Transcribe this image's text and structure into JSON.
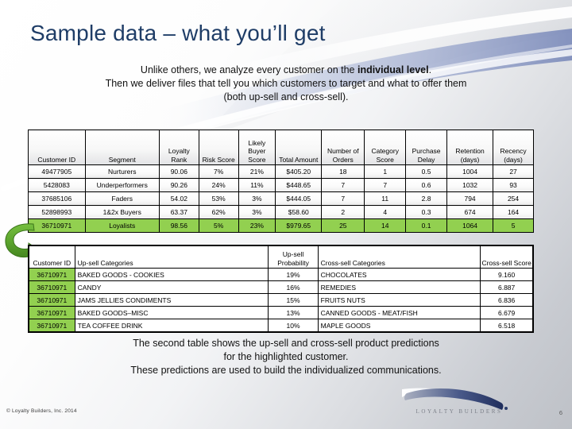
{
  "slide": {
    "title": "Sample data – what you’ll get",
    "intro_line1_a": "Unlike others, we analyze every customer on the ",
    "intro_line1_b": "individual level",
    "intro_line1_c": ".",
    "intro_line2": "Then we deliver files that tell you which customers to target and what to offer them",
    "intro_line3": "(both up-sell and cross-sell).",
    "outro_line1": "The second table shows the up-sell and cross-sell product predictions",
    "outro_line2": "for the highlighted customer.",
    "outro_line3": "These predictions are used to build the individualized communications.",
    "copyright": "© Loyalty Builders, Inc. 2014",
    "page_number": "6",
    "logo_text": "LOYALTY BUILDERS",
    "accent_green": "#92D050",
    "title_color": "#1F3D67",
    "logo_color": "#2B3D6B"
  },
  "customer_table": {
    "headers": [
      "Customer ID",
      "Segment",
      "Loyalty Rank",
      "Risk Score",
      "Likely Buyer Score",
      "Total Amount",
      "Number of Orders",
      "Category Score",
      "Purchase Delay",
      "Retention (days)",
      "Recency (days)"
    ],
    "rows": [
      {
        "highlighted": false,
        "cells": [
          "49477905",
          "Nurturers",
          "90.06",
          "7%",
          "21%",
          "$405.20",
          "18",
          "1",
          "0.5",
          "1004",
          "27"
        ]
      },
      {
        "highlighted": false,
        "cells": [
          "5428083",
          "Underperformers",
          "90.26",
          "24%",
          "11%",
          "$448.65",
          "7",
          "7",
          "0.6",
          "1032",
          "93"
        ]
      },
      {
        "highlighted": false,
        "cells": [
          "37685106",
          "Faders",
          "54.02",
          "53%",
          "3%",
          "$444.05",
          "7",
          "11",
          "2.8",
          "794",
          "254"
        ]
      },
      {
        "highlighted": false,
        "cells": [
          "52898993",
          "1&2x Buyers",
          "63.37",
          "62%",
          "3%",
          "$58.60",
          "2",
          "4",
          "0.3",
          "674",
          "164"
        ]
      },
      {
        "highlighted": true,
        "cells": [
          "36710971",
          "Loyalists",
          "98.56",
          "5%",
          "23%",
          "$979.65",
          "25",
          "14",
          "0.1",
          "1064",
          "5"
        ]
      }
    ]
  },
  "predictions_table": {
    "headers": [
      "Customer ID",
      "Up-sell Categories",
      "Up-sell Probability",
      "Cross-sell Categories",
      "Cross-sell Score"
    ],
    "rows": [
      {
        "customer_id": "36710971",
        "upsell_category": "BAKED GOODS - COOKIES",
        "upsell_probability": "19%",
        "crosssell_category": "CHOCOLATES",
        "crosssell_score": "9.160"
      },
      {
        "customer_id": "36710971",
        "upsell_category": "CANDY",
        "upsell_probability": "16%",
        "crosssell_category": "REMEDIES",
        "crosssell_score": "6.887"
      },
      {
        "customer_id": "36710971",
        "upsell_category": "JAMS JELLIES CONDIMENTS",
        "upsell_probability": "15%",
        "crosssell_category": "FRUITS NUTS",
        "crosssell_score": "6.836"
      },
      {
        "customer_id": "36710971",
        "upsell_category": "BAKED GOODS–MISC",
        "upsell_probability": "13%",
        "crosssell_category": "CANNED GOODS - MEAT/FISH",
        "crosssell_score": "6.679"
      },
      {
        "customer_id": "36710971",
        "upsell_category": "TEA COFFEE DRINK",
        "upsell_probability": "10%",
        "crosssell_category": "MAPLE GOODS",
        "crosssell_score": "6.518"
      }
    ]
  }
}
